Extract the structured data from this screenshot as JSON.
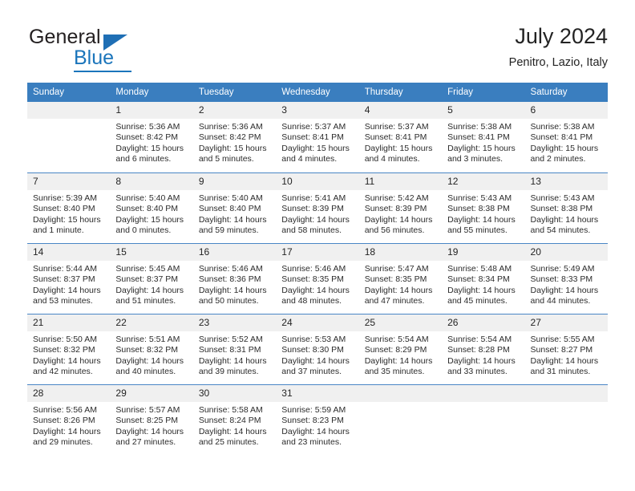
{
  "brand": {
    "name_top": "General",
    "name_bottom": "Blue",
    "triangle_icon": "triangle-icon",
    "accent_color": "#1b75bb",
    "text_color": "#231f20"
  },
  "header": {
    "title": "July 2024",
    "subtitle": "Penitro, Lazio, Italy"
  },
  "calendar": {
    "header_bg": "#3a7ebf",
    "header_text_color": "#ffffff",
    "daynum_bg": "#f0f0f0",
    "weekday_headers": [
      "Sunday",
      "Monday",
      "Tuesday",
      "Wednesday",
      "Thursday",
      "Friday",
      "Saturday"
    ],
    "weeks": [
      [
        {
          "day": "",
          "sunrise": "",
          "sunset": "",
          "daylight": "",
          "daylight_cont": ""
        },
        {
          "day": "1",
          "sunrise": "Sunrise: 5:36 AM",
          "sunset": "Sunset: 8:42 PM",
          "daylight": "Daylight: 15 hours",
          "daylight_cont": "and 6 minutes."
        },
        {
          "day": "2",
          "sunrise": "Sunrise: 5:36 AM",
          "sunset": "Sunset: 8:42 PM",
          "daylight": "Daylight: 15 hours",
          "daylight_cont": "and 5 minutes."
        },
        {
          "day": "3",
          "sunrise": "Sunrise: 5:37 AM",
          "sunset": "Sunset: 8:41 PM",
          "daylight": "Daylight: 15 hours",
          "daylight_cont": "and 4 minutes."
        },
        {
          "day": "4",
          "sunrise": "Sunrise: 5:37 AM",
          "sunset": "Sunset: 8:41 PM",
          "daylight": "Daylight: 15 hours",
          "daylight_cont": "and 4 minutes."
        },
        {
          "day": "5",
          "sunrise": "Sunrise: 5:38 AM",
          "sunset": "Sunset: 8:41 PM",
          "daylight": "Daylight: 15 hours",
          "daylight_cont": "and 3 minutes."
        },
        {
          "day": "6",
          "sunrise": "Sunrise: 5:38 AM",
          "sunset": "Sunset: 8:41 PM",
          "daylight": "Daylight: 15 hours",
          "daylight_cont": "and 2 minutes."
        }
      ],
      [
        {
          "day": "7",
          "sunrise": "Sunrise: 5:39 AM",
          "sunset": "Sunset: 8:40 PM",
          "daylight": "Daylight: 15 hours",
          "daylight_cont": "and 1 minute."
        },
        {
          "day": "8",
          "sunrise": "Sunrise: 5:40 AM",
          "sunset": "Sunset: 8:40 PM",
          "daylight": "Daylight: 15 hours",
          "daylight_cont": "and 0 minutes."
        },
        {
          "day": "9",
          "sunrise": "Sunrise: 5:40 AM",
          "sunset": "Sunset: 8:40 PM",
          "daylight": "Daylight: 14 hours",
          "daylight_cont": "and 59 minutes."
        },
        {
          "day": "10",
          "sunrise": "Sunrise: 5:41 AM",
          "sunset": "Sunset: 8:39 PM",
          "daylight": "Daylight: 14 hours",
          "daylight_cont": "and 58 minutes."
        },
        {
          "day": "11",
          "sunrise": "Sunrise: 5:42 AM",
          "sunset": "Sunset: 8:39 PM",
          "daylight": "Daylight: 14 hours",
          "daylight_cont": "and 56 minutes."
        },
        {
          "day": "12",
          "sunrise": "Sunrise: 5:43 AM",
          "sunset": "Sunset: 8:38 PM",
          "daylight": "Daylight: 14 hours",
          "daylight_cont": "and 55 minutes."
        },
        {
          "day": "13",
          "sunrise": "Sunrise: 5:43 AM",
          "sunset": "Sunset: 8:38 PM",
          "daylight": "Daylight: 14 hours",
          "daylight_cont": "and 54 minutes."
        }
      ],
      [
        {
          "day": "14",
          "sunrise": "Sunrise: 5:44 AM",
          "sunset": "Sunset: 8:37 PM",
          "daylight": "Daylight: 14 hours",
          "daylight_cont": "and 53 minutes."
        },
        {
          "day": "15",
          "sunrise": "Sunrise: 5:45 AM",
          "sunset": "Sunset: 8:37 PM",
          "daylight": "Daylight: 14 hours",
          "daylight_cont": "and 51 minutes."
        },
        {
          "day": "16",
          "sunrise": "Sunrise: 5:46 AM",
          "sunset": "Sunset: 8:36 PM",
          "daylight": "Daylight: 14 hours",
          "daylight_cont": "and 50 minutes."
        },
        {
          "day": "17",
          "sunrise": "Sunrise: 5:46 AM",
          "sunset": "Sunset: 8:35 PM",
          "daylight": "Daylight: 14 hours",
          "daylight_cont": "and 48 minutes."
        },
        {
          "day": "18",
          "sunrise": "Sunrise: 5:47 AM",
          "sunset": "Sunset: 8:35 PM",
          "daylight": "Daylight: 14 hours",
          "daylight_cont": "and 47 minutes."
        },
        {
          "day": "19",
          "sunrise": "Sunrise: 5:48 AM",
          "sunset": "Sunset: 8:34 PM",
          "daylight": "Daylight: 14 hours",
          "daylight_cont": "and 45 minutes."
        },
        {
          "day": "20",
          "sunrise": "Sunrise: 5:49 AM",
          "sunset": "Sunset: 8:33 PM",
          "daylight": "Daylight: 14 hours",
          "daylight_cont": "and 44 minutes."
        }
      ],
      [
        {
          "day": "21",
          "sunrise": "Sunrise: 5:50 AM",
          "sunset": "Sunset: 8:32 PM",
          "daylight": "Daylight: 14 hours",
          "daylight_cont": "and 42 minutes."
        },
        {
          "day": "22",
          "sunrise": "Sunrise: 5:51 AM",
          "sunset": "Sunset: 8:32 PM",
          "daylight": "Daylight: 14 hours",
          "daylight_cont": "and 40 minutes."
        },
        {
          "day": "23",
          "sunrise": "Sunrise: 5:52 AM",
          "sunset": "Sunset: 8:31 PM",
          "daylight": "Daylight: 14 hours",
          "daylight_cont": "and 39 minutes."
        },
        {
          "day": "24",
          "sunrise": "Sunrise: 5:53 AM",
          "sunset": "Sunset: 8:30 PM",
          "daylight": "Daylight: 14 hours",
          "daylight_cont": "and 37 minutes."
        },
        {
          "day": "25",
          "sunrise": "Sunrise: 5:54 AM",
          "sunset": "Sunset: 8:29 PM",
          "daylight": "Daylight: 14 hours",
          "daylight_cont": "and 35 minutes."
        },
        {
          "day": "26",
          "sunrise": "Sunrise: 5:54 AM",
          "sunset": "Sunset: 8:28 PM",
          "daylight": "Daylight: 14 hours",
          "daylight_cont": "and 33 minutes."
        },
        {
          "day": "27",
          "sunrise": "Sunrise: 5:55 AM",
          "sunset": "Sunset: 8:27 PM",
          "daylight": "Daylight: 14 hours",
          "daylight_cont": "and 31 minutes."
        }
      ],
      [
        {
          "day": "28",
          "sunrise": "Sunrise: 5:56 AM",
          "sunset": "Sunset: 8:26 PM",
          "daylight": "Daylight: 14 hours",
          "daylight_cont": "and 29 minutes."
        },
        {
          "day": "29",
          "sunrise": "Sunrise: 5:57 AM",
          "sunset": "Sunset: 8:25 PM",
          "daylight": "Daylight: 14 hours",
          "daylight_cont": "and 27 minutes."
        },
        {
          "day": "30",
          "sunrise": "Sunrise: 5:58 AM",
          "sunset": "Sunset: 8:24 PM",
          "daylight": "Daylight: 14 hours",
          "daylight_cont": "and 25 minutes."
        },
        {
          "day": "31",
          "sunrise": "Sunrise: 5:59 AM",
          "sunset": "Sunset: 8:23 PM",
          "daylight": "Daylight: 14 hours",
          "daylight_cont": "and 23 minutes."
        },
        {
          "day": "",
          "sunrise": "",
          "sunset": "",
          "daylight": "",
          "daylight_cont": ""
        },
        {
          "day": "",
          "sunrise": "",
          "sunset": "",
          "daylight": "",
          "daylight_cont": ""
        },
        {
          "day": "",
          "sunrise": "",
          "sunset": "",
          "daylight": "",
          "daylight_cont": ""
        }
      ]
    ]
  }
}
